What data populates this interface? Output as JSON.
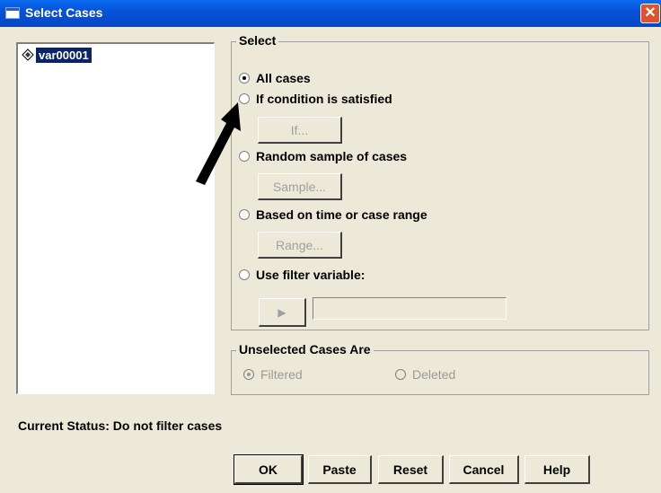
{
  "window": {
    "title": "Select Cases",
    "close_glyph": "✕"
  },
  "variables": [
    "var00001"
  ],
  "select_group": {
    "title": "Select",
    "options": [
      {
        "label": "All cases",
        "checked": true
      },
      {
        "label": "If condition is satisfied",
        "checked": false
      },
      {
        "label": "Random sample of cases",
        "checked": false
      },
      {
        "label": "Based on time or case range",
        "checked": false
      },
      {
        "label": "Use filter variable:",
        "checked": false
      }
    ],
    "if_button": "If...",
    "sample_button": "Sample...",
    "range_button": "Range...",
    "filter_arrow_glyph": "▶"
  },
  "unselected_group": {
    "title": "Unselected Cases Are",
    "filtered_label": "Filtered",
    "deleted_label": "Deleted"
  },
  "status_text": "Current Status: Do not filter cases",
  "buttons": {
    "ok": "OK",
    "paste": "Paste",
    "reset": "Reset",
    "cancel": "Cancel",
    "help": "Help"
  }
}
